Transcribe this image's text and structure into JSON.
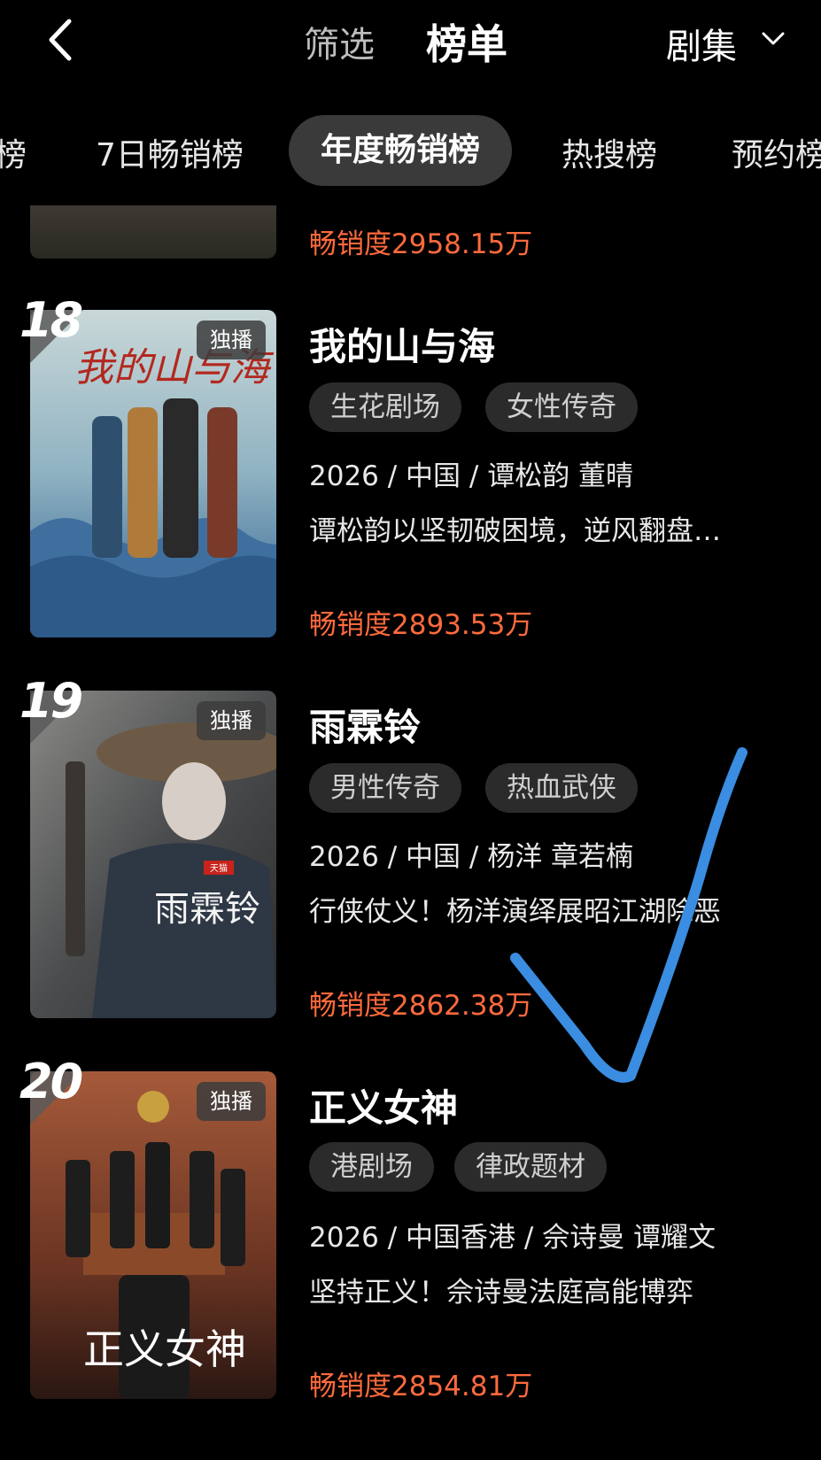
{
  "header": {
    "back_icon": "chevron-left-icon",
    "filter_label": "筛选",
    "rank_label": "榜单",
    "category_label": "剧集",
    "category_icon": "chevron-down-icon"
  },
  "tabs": [
    {
      "label": "榜"
    },
    {
      "label": "7日畅销榜"
    },
    {
      "label": "年度畅销榜",
      "active": true
    },
    {
      "label": "热搜榜"
    },
    {
      "label": "预约榜"
    }
  ],
  "previous_item": {
    "sales": "畅销度2958.15万"
  },
  "items": [
    {
      "rank": "18",
      "badge": "独播",
      "title": "我的山与海",
      "tags": [
        "生花剧场",
        "女性传奇"
      ],
      "meta": "2026 / 中国 / 谭松韵 董晴",
      "desc": "谭松韵以坚韧破困境，逆风翻盘…",
      "sales": "畅销度2893.53万",
      "poster_title": "我的山与海"
    },
    {
      "rank": "19",
      "badge": "独播",
      "title": "雨霖铃",
      "tags": [
        "男性传奇",
        "热血武侠"
      ],
      "meta": "2026 / 中国 / 杨洋 章若楠",
      "desc": "行侠仗义！杨洋演绎展昭江湖除恶",
      "sales": "畅销度2862.38万",
      "poster_title": "雨霖铃",
      "poster_sub": "天猫"
    },
    {
      "rank": "20",
      "badge": "独播",
      "title": "正义女神",
      "tags": [
        "港剧场",
        "律政题材"
      ],
      "meta": "2026 / 中国香港 / 佘诗曼 谭耀文",
      "desc": "坚持正义！佘诗曼法庭高能博弈",
      "sales": "畅销度2854.81万",
      "poster_title": "正义女神"
    }
  ],
  "colors": {
    "background": "#000000",
    "accent_sales": "#ff6a3d",
    "tag_bg": "#2b2b2b",
    "active_tab_bg": "#3a3a3a",
    "checkmark": "#3a8de0"
  }
}
